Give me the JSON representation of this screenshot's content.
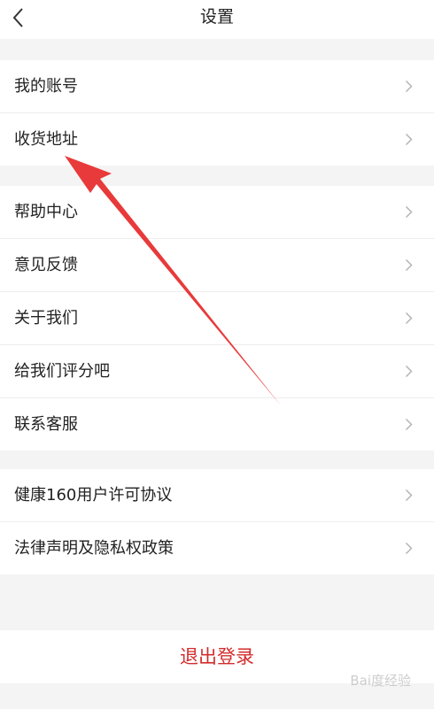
{
  "header": {
    "title": "设置",
    "back_icon": "chevron-left-icon"
  },
  "groups": [
    {
      "items": [
        {
          "label": "我的账号"
        },
        {
          "label": "收货地址"
        }
      ]
    },
    {
      "items": [
        {
          "label": "帮助中心"
        },
        {
          "label": "意见反馈"
        },
        {
          "label": "关于我们"
        },
        {
          "label": "给我们评分吧"
        },
        {
          "label": "联系客服"
        }
      ]
    },
    {
      "items": [
        {
          "label": "健康160用户许可协议"
        },
        {
          "label": "法律声明及隐私权政策"
        }
      ]
    }
  ],
  "logout": {
    "label": "退出登录",
    "color": "#d22d2d"
  },
  "annotation": {
    "type": "arrow",
    "color": "#e83a3a"
  },
  "watermark": {
    "text": "Bai度经验"
  }
}
